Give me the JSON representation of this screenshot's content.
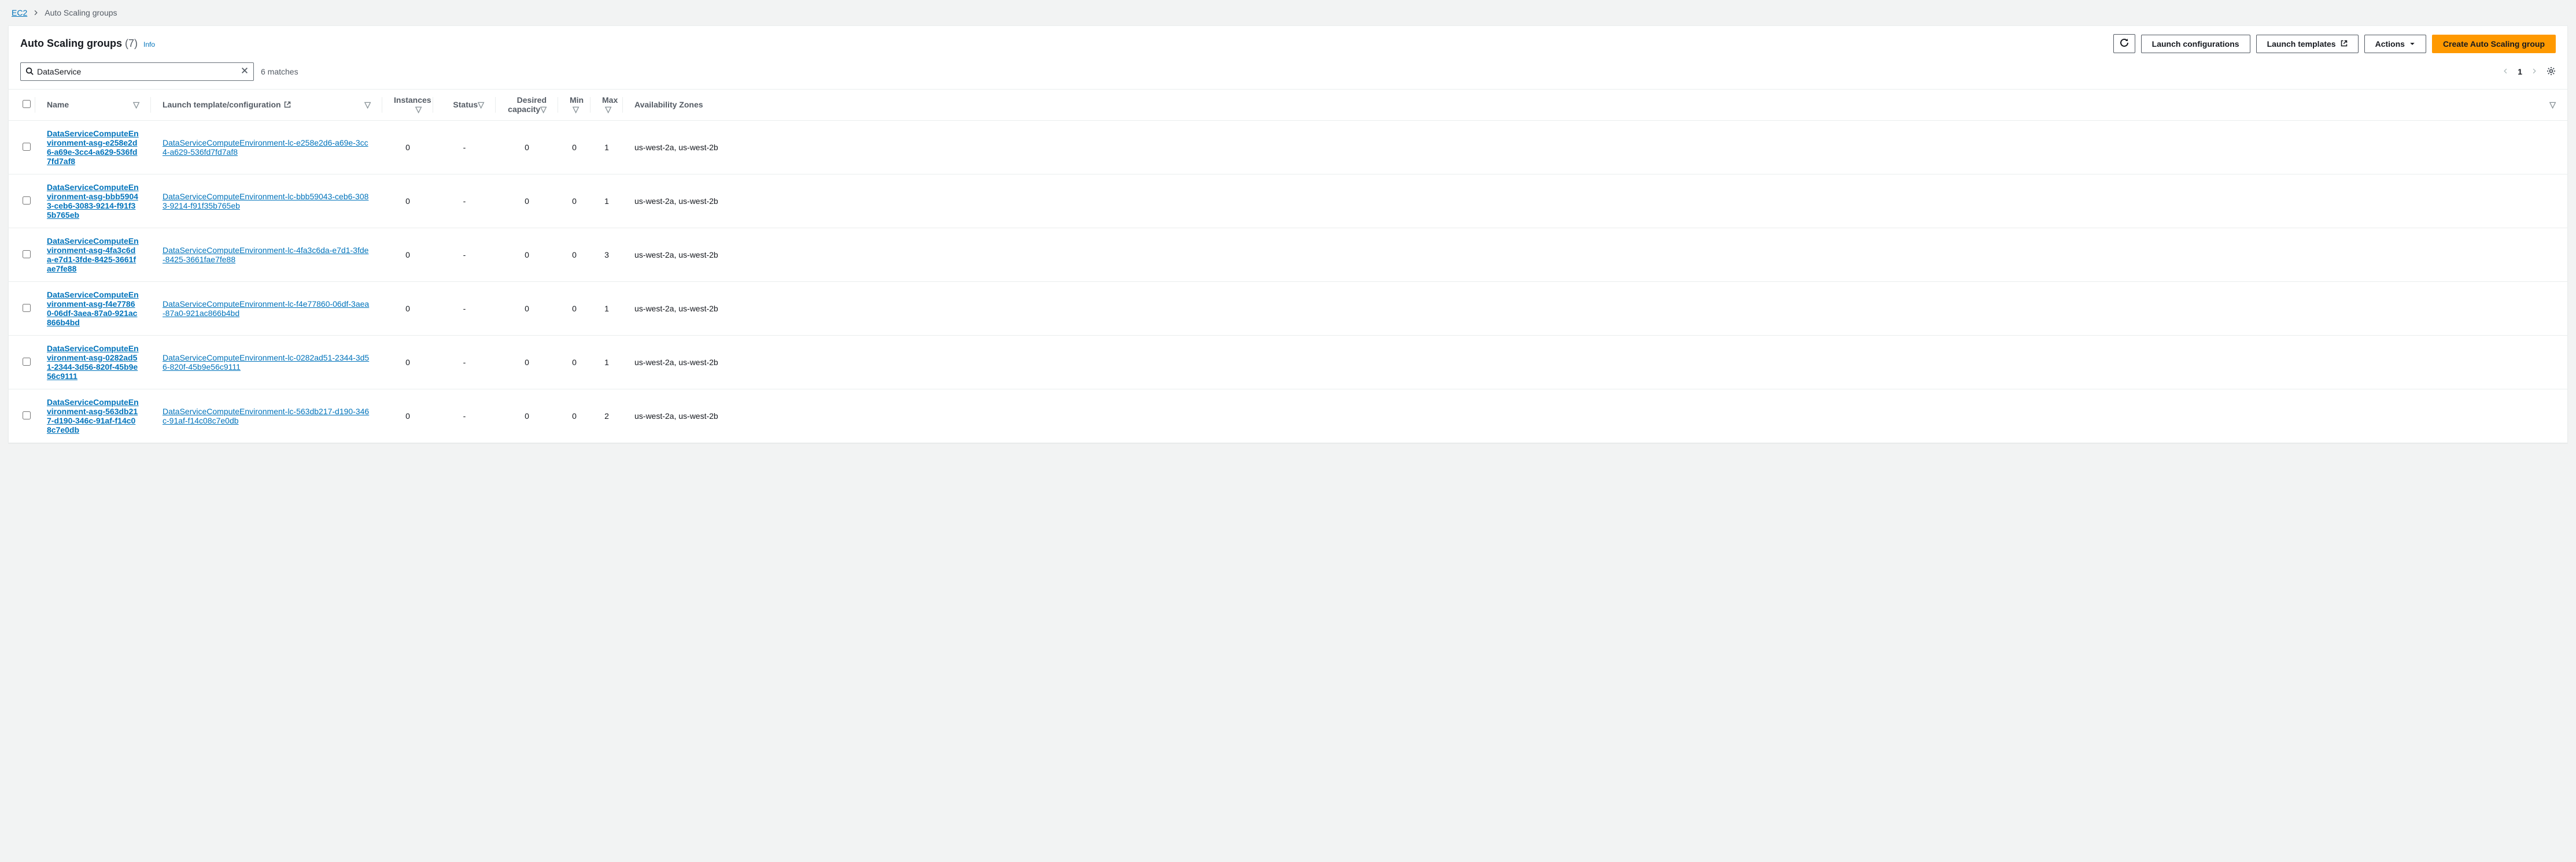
{
  "breadcrumbs": {
    "root": "EC2",
    "current": "Auto Scaling groups"
  },
  "header": {
    "title": "Auto Scaling groups",
    "count": "(7)",
    "info": "Info"
  },
  "actions": {
    "launch_configs": "Launch configurations",
    "launch_templates": "Launch templates",
    "actions": "Actions",
    "create": "Create Auto Scaling group"
  },
  "search": {
    "value": "DataService",
    "matches": "6 matches"
  },
  "pagination": {
    "page": "1"
  },
  "columns": {
    "name": "Name",
    "template": "Launch template/configuration",
    "instances": "Instances",
    "status": "Status",
    "desired": "Desired capacity",
    "min": "Min",
    "max": "Max",
    "az": "Availability Zones"
  },
  "rows": [
    {
      "name": "DataServiceComputeEnvironment-asg-e258e2d6-a69e-3cc4-a629-536fd7fd7af8",
      "template": "DataServiceComputeEnvironment-lc-e258e2d6-a69e-3cc4-a629-536fd7fd7af8",
      "instances": "0",
      "status": "-",
      "desired": "0",
      "min": "0",
      "max": "1",
      "az": "us-west-2a, us-west-2b"
    },
    {
      "name": "DataServiceComputeEnvironment-asg-bbb59043-ceb6-3083-9214-f91f35b765eb",
      "template": "DataServiceComputeEnvironment-lc-bbb59043-ceb6-3083-9214-f91f35b765eb",
      "instances": "0",
      "status": "-",
      "desired": "0",
      "min": "0",
      "max": "1",
      "az": "us-west-2a, us-west-2b"
    },
    {
      "name": "DataServiceComputeEnvironment-asg-4fa3c6da-e7d1-3fde-8425-3661fae7fe88",
      "template": "DataServiceComputeEnvironment-lc-4fa3c6da-e7d1-3fde-8425-3661fae7fe88",
      "instances": "0",
      "status": "-",
      "desired": "0",
      "min": "0",
      "max": "3",
      "az": "us-west-2a, us-west-2b"
    },
    {
      "name": "DataServiceComputeEnvironment-asg-f4e77860-06df-3aea-87a0-921ac866b4bd",
      "template": "DataServiceComputeEnvironment-lc-f4e77860-06df-3aea-87a0-921ac866b4bd",
      "instances": "0",
      "status": "-",
      "desired": "0",
      "min": "0",
      "max": "1",
      "az": "us-west-2a, us-west-2b"
    },
    {
      "name": "DataServiceComputeEnvironment-asg-0282ad51-2344-3d56-820f-45b9e56c9111",
      "template": "DataServiceComputeEnvironment-lc-0282ad51-2344-3d56-820f-45b9e56c9111",
      "instances": "0",
      "status": "-",
      "desired": "0",
      "min": "0",
      "max": "1",
      "az": "us-west-2a, us-west-2b"
    },
    {
      "name": "DataServiceComputeEnvironment-asg-563db217-d190-346c-91af-f14c08c7e0db",
      "template": "DataServiceComputeEnvironment-lc-563db217-d190-346c-91af-f14c08c7e0db",
      "instances": "0",
      "status": "-",
      "desired": "0",
      "min": "0",
      "max": "2",
      "az": "us-west-2a, us-west-2b"
    }
  ]
}
